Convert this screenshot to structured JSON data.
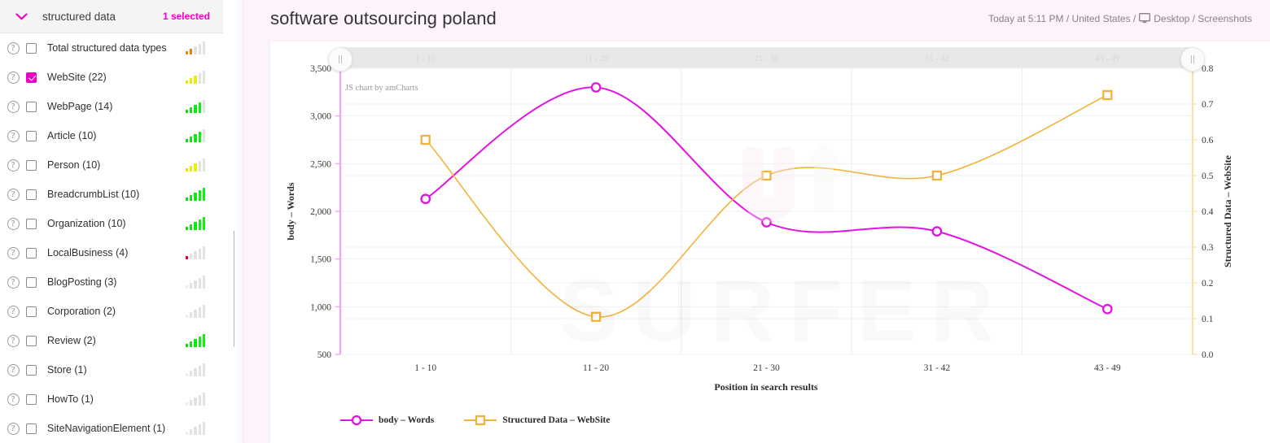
{
  "sidebar": {
    "header": {
      "caret_icon": "chevron-down-icon",
      "title": "structured data",
      "selected_label": "1 selected"
    },
    "items": [
      {
        "label": "Total structured data types",
        "checked": false,
        "help_icon": "question-mark-icon",
        "bars": [
          {
            "h": 4,
            "c": "#e8820c"
          },
          {
            "h": 7,
            "c": "#f07d00"
          },
          {
            "h": 10,
            "c": "#e2e2e2"
          },
          {
            "h": 13,
            "c": "#e2e2e2"
          },
          {
            "h": 16,
            "c": "#e2e2e2"
          }
        ]
      },
      {
        "label": "WebSite (22)",
        "checked": true,
        "help_icon": "question-mark-icon",
        "bars": [
          {
            "h": 4,
            "c": "#e8e200"
          },
          {
            "h": 7,
            "c": "#eded00"
          },
          {
            "h": 10,
            "c": "#ecec10"
          },
          {
            "h": 13,
            "c": "#e2e2e2"
          },
          {
            "h": 16,
            "c": "#e2e2e2"
          }
        ]
      },
      {
        "label": "WebPage (14)",
        "checked": false,
        "help_icon": "question-mark-icon",
        "bars": [
          {
            "h": 4,
            "c": "#16d416"
          },
          {
            "h": 7,
            "c": "#16e016"
          },
          {
            "h": 10,
            "c": "#13e613"
          },
          {
            "h": 13,
            "c": "#10ee10"
          },
          {
            "h": 16,
            "c": "#e2e2e2"
          }
        ]
      },
      {
        "label": "Article (10)",
        "checked": false,
        "help_icon": "question-mark-icon",
        "bars": [
          {
            "h": 4,
            "c": "#16d416"
          },
          {
            "h": 7,
            "c": "#16e016"
          },
          {
            "h": 10,
            "c": "#13e613"
          },
          {
            "h": 13,
            "c": "#10ee10"
          },
          {
            "h": 16,
            "c": "#e2e2e2"
          }
        ]
      },
      {
        "label": "Person (10)",
        "checked": false,
        "help_icon": "question-mark-icon",
        "bars": [
          {
            "h": 4,
            "c": "#e8e200"
          },
          {
            "h": 7,
            "c": "#eded00"
          },
          {
            "h": 10,
            "c": "#ecec10"
          },
          {
            "h": 13,
            "c": "#e2e2e2"
          },
          {
            "h": 16,
            "c": "#e2e2e2"
          }
        ]
      },
      {
        "label": "BreadcrumbList (10)",
        "checked": false,
        "help_icon": "question-mark-icon",
        "bars": [
          {
            "h": 4,
            "c": "#16d416"
          },
          {
            "h": 7,
            "c": "#16e016"
          },
          {
            "h": 10,
            "c": "#13e613"
          },
          {
            "h": 13,
            "c": "#10ee10"
          },
          {
            "h": 16,
            "c": "#0cf40c"
          }
        ]
      },
      {
        "label": "Organization (10)",
        "checked": false,
        "help_icon": "question-mark-icon",
        "bars": [
          {
            "h": 4,
            "c": "#16d416"
          },
          {
            "h": 7,
            "c": "#16e016"
          },
          {
            "h": 10,
            "c": "#13e613"
          },
          {
            "h": 13,
            "c": "#10ee10"
          },
          {
            "h": 16,
            "c": "#0cf40c"
          }
        ]
      },
      {
        "label": "LocalBusiness (4)",
        "checked": false,
        "help_icon": "question-mark-icon",
        "bars": [
          {
            "h": 4,
            "c": "#e8002a"
          },
          {
            "h": 7,
            "c": "#e2e2e2"
          },
          {
            "h": 10,
            "c": "#e2e2e2"
          },
          {
            "h": 13,
            "c": "#e2e2e2"
          },
          {
            "h": 16,
            "c": "#e2e2e2"
          }
        ]
      },
      {
        "label": "BlogPosting (3)",
        "checked": false,
        "help_icon": "question-mark-icon",
        "bars": [
          {
            "h": 4,
            "c": "#ececec"
          },
          {
            "h": 7,
            "c": "#e2e2e2"
          },
          {
            "h": 10,
            "c": "#e2e2e2"
          },
          {
            "h": 13,
            "c": "#e2e2e2"
          },
          {
            "h": 16,
            "c": "#e2e2e2"
          }
        ]
      },
      {
        "label": "Corporation (2)",
        "checked": false,
        "help_icon": "question-mark-icon",
        "bars": [
          {
            "h": 4,
            "c": "#ececec"
          },
          {
            "h": 7,
            "c": "#e2e2e2"
          },
          {
            "h": 10,
            "c": "#e2e2e2"
          },
          {
            "h": 13,
            "c": "#e2e2e2"
          },
          {
            "h": 16,
            "c": "#e2e2e2"
          }
        ]
      },
      {
        "label": "Review (2)",
        "checked": false,
        "help_icon": "question-mark-icon",
        "bars": [
          {
            "h": 4,
            "c": "#16d416"
          },
          {
            "h": 7,
            "c": "#16e016"
          },
          {
            "h": 10,
            "c": "#13e613"
          },
          {
            "h": 13,
            "c": "#10ee10"
          },
          {
            "h": 16,
            "c": "#0cf40c"
          }
        ]
      },
      {
        "label": "Store (1)",
        "checked": false,
        "help_icon": "question-mark-icon",
        "bars": [
          {
            "h": 4,
            "c": "#ececec"
          },
          {
            "h": 7,
            "c": "#e2e2e2"
          },
          {
            "h": 10,
            "c": "#e2e2e2"
          },
          {
            "h": 13,
            "c": "#e2e2e2"
          },
          {
            "h": 16,
            "c": "#e2e2e2"
          }
        ]
      },
      {
        "label": "HowTo (1)",
        "checked": false,
        "help_icon": "question-mark-icon",
        "bars": [
          {
            "h": 4,
            "c": "#ececec"
          },
          {
            "h": 7,
            "c": "#e2e2e2"
          },
          {
            "h": 10,
            "c": "#e2e2e2"
          },
          {
            "h": 13,
            "c": "#e2e2e2"
          },
          {
            "h": 16,
            "c": "#e2e2e2"
          }
        ]
      },
      {
        "label": "SiteNavigationElement (1)",
        "checked": false,
        "help_icon": "question-mark-icon",
        "bars": [
          {
            "h": 4,
            "c": "#ececec"
          },
          {
            "h": 7,
            "c": "#e2e2e2"
          },
          {
            "h": 10,
            "c": "#e2e2e2"
          },
          {
            "h": 13,
            "c": "#e2e2e2"
          },
          {
            "h": 16,
            "c": "#e2e2e2"
          }
        ]
      }
    ]
  },
  "header": {
    "title": "software outsourcing poland",
    "meta_text": "Today at 5:11 PM / United States /",
    "device_icon": "desktop-monitor-icon",
    "meta_tail": "Desktop / Screenshots"
  },
  "chart_panel": {
    "credit": "JS chart by amCharts",
    "watermark": "SURFER",
    "grip_left_icon": "drag-handle-icon",
    "grip_right_icon": "drag-handle-icon",
    "scrollbar_labels": [
      "1 - 10",
      "11 - 20",
      "21 - 30",
      "31 - 42",
      "43 - 49"
    ]
  },
  "colors": {
    "accent": "#ee00cc",
    "series_words": "#e312e3",
    "series_structured": "#f2b33d",
    "panel_bg": "#fdf3fa"
  },
  "chart_data": {
    "type": "line",
    "title": "",
    "xlabel": "Position in search results",
    "categories": [
      "1 - 10",
      "11 - 20",
      "21 - 30",
      "31 - 42",
      "43 - 49"
    ],
    "grid": true,
    "legend_position": "bottom-left",
    "axes": {
      "left": {
        "label": "body – Words",
        "ticks": [
          500,
          1000,
          1500,
          2000,
          2500,
          3000,
          3500
        ],
        "min": 500,
        "max": 3500,
        "color": "#e312e3"
      },
      "right": {
        "label": "Structured Data – WebSite",
        "ticks": [
          0.0,
          0.1,
          0.2,
          0.3,
          0.4,
          0.5,
          0.6,
          0.7,
          0.8
        ],
        "min": 0.0,
        "max": 0.8,
        "color": "#f2b33d"
      }
    },
    "series": [
      {
        "name": "body – Words",
        "axis": "left",
        "color": "#e312e3",
        "marker": "circle",
        "values": [
          2130,
          3300,
          1885,
          1790,
          975
        ]
      },
      {
        "name": "Structured Data – WebSite",
        "axis": "right",
        "color": "#f2b33d",
        "marker": "square",
        "values": [
          0.6,
          0.105,
          0.5,
          0.5,
          0.725
        ]
      }
    ]
  }
}
